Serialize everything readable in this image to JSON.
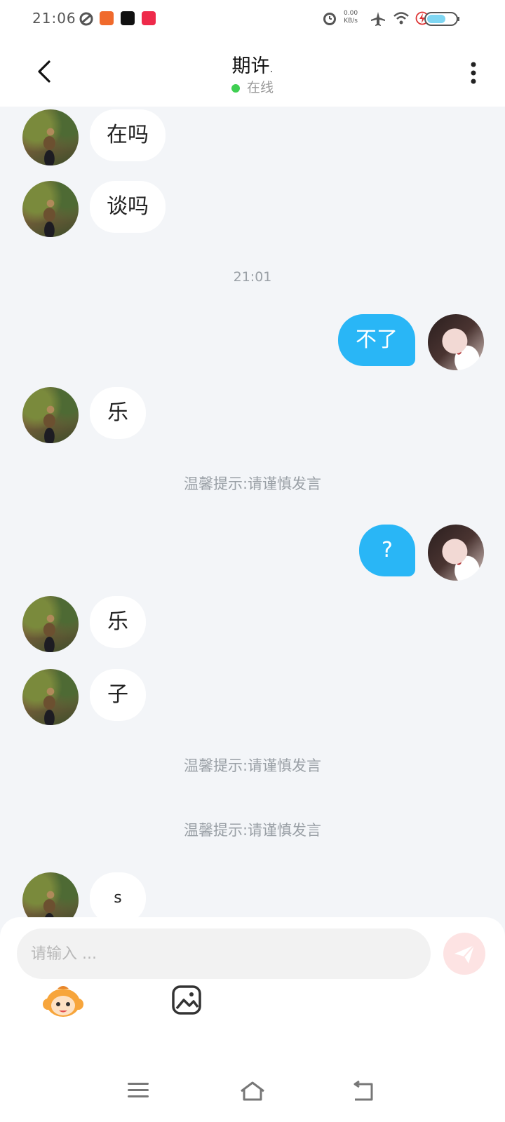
{
  "status_bar": {
    "time": "21:06",
    "net_speed_value": "0.00",
    "net_speed_unit": "KB/s"
  },
  "header": {
    "title": "期许",
    "title_suffix": ".",
    "status": "在线"
  },
  "messages": [
    {
      "side": "in",
      "text": "在吗"
    },
    {
      "side": "in",
      "text": "谈吗"
    },
    {
      "type": "time",
      "text": "21:01"
    },
    {
      "side": "out",
      "text": "不了"
    },
    {
      "side": "in",
      "text": "乐"
    },
    {
      "type": "tip",
      "text": "温馨提示:请谨慎发言"
    },
    {
      "side": "out",
      "text": "?"
    },
    {
      "side": "in",
      "text": "乐"
    },
    {
      "side": "in",
      "text": "子"
    },
    {
      "type": "tip",
      "text": "温馨提示:请谨慎发言"
    },
    {
      "type": "tip",
      "text": "温馨提示:请谨慎发言"
    },
    {
      "side": "in",
      "text": "s"
    }
  ],
  "composer": {
    "placeholder": "请输入 ..."
  },
  "colors": {
    "accent": "#29b6f6",
    "online": "#3fcf52",
    "send_bg": "#fde3e3"
  }
}
